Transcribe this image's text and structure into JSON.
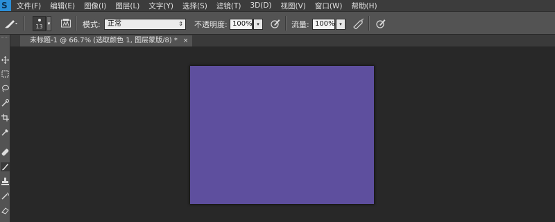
{
  "app": {
    "logo_text": "S"
  },
  "menu": [
    "文件(F)",
    "编辑(E)",
    "图像(I)",
    "图层(L)",
    "文字(Y)",
    "选择(S)",
    "滤镜(T)",
    "3D(D)",
    "视图(V)",
    "窗口(W)",
    "帮助(H)"
  ],
  "options": {
    "brush_size": "13",
    "mode_label": "模式:",
    "mode_value": "正常",
    "opacity_label": "不透明度:",
    "opacity_value": "100%",
    "flow_label": "流量:",
    "flow_value": "100%"
  },
  "document": {
    "tab_title": "未标题-1 @ 66.7% (选取颜色 1, 图层蒙版/8) *",
    "close_glyph": "×"
  },
  "canvas": {
    "fill_color": "#5e4f9e"
  },
  "icons": {
    "tool_preset": "brush-tool-icon",
    "brush_panel": "brush-panel-toggle-icon",
    "opacity_pressure": "tablet-pressure-opacity-icon",
    "airbrush": "airbrush-icon",
    "flow_pressure": "tablet-pressure-size-icon"
  }
}
